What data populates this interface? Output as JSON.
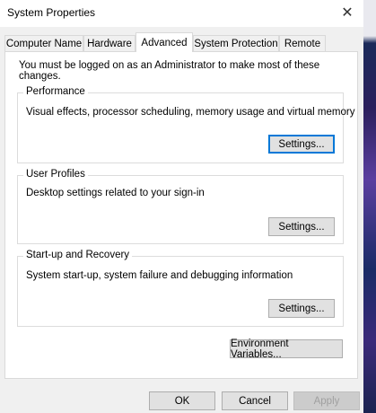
{
  "window": {
    "title": "System Properties",
    "close_glyph": "✕"
  },
  "tabs": [
    {
      "label": "Computer Name"
    },
    {
      "label": "Hardware"
    },
    {
      "label": "Advanced"
    },
    {
      "label": "System Protection"
    },
    {
      "label": "Remote"
    }
  ],
  "active_tab": "Advanced",
  "advanced": {
    "admin_note": "You must be logged on as an Administrator to make most of these changes.",
    "performance": {
      "title": "Performance",
      "description": "Visual effects, processor scheduling, memory usage and virtual memory",
      "button": "Settings..."
    },
    "user_profiles": {
      "title": "User Profiles",
      "description": "Desktop settings related to your sign-in",
      "button": "Settings..."
    },
    "startup_recovery": {
      "title": "Start-up and Recovery",
      "description": "System start-up, system failure and debugging information",
      "button": "Settings..."
    },
    "env_button": "Environment Variables..."
  },
  "footer": {
    "ok": "OK",
    "cancel": "Cancel",
    "apply": "Apply"
  },
  "colors": {
    "focus": "#0078d7",
    "dialog_bg": "#f0f0f0",
    "panel_bg": "#ffffff"
  }
}
